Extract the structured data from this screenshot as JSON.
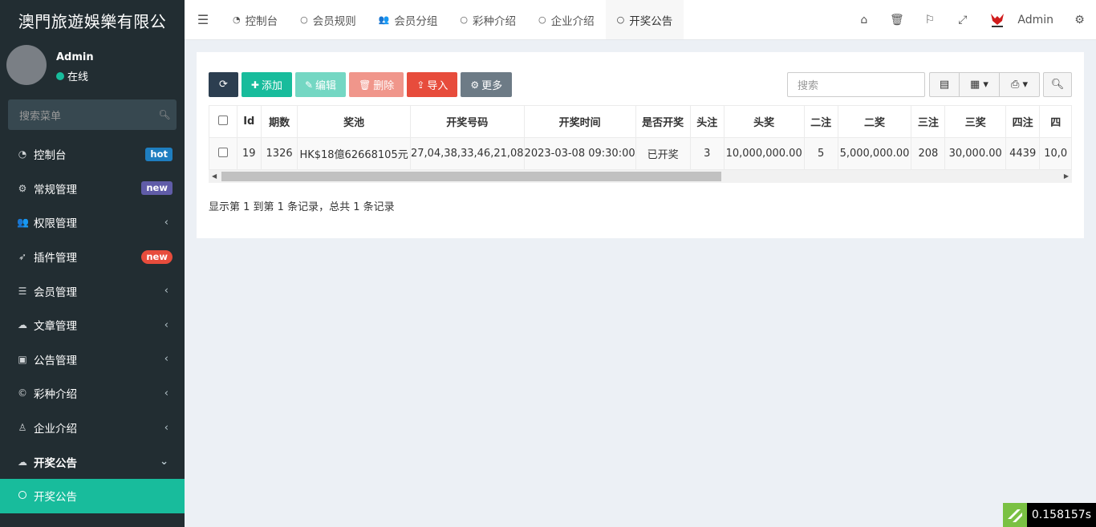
{
  "brand": "澳門旅遊娛樂有限公",
  "user": {
    "name": "Admin",
    "status": "在线"
  },
  "sidebar": {
    "search_placeholder": "搜索菜单",
    "items": [
      {
        "icon": "dashboard-icon",
        "glyph": "◔",
        "label": "控制台",
        "badge": "hot",
        "badge_color": "#1e7ec0"
      },
      {
        "icon": "cogs-icon",
        "glyph": "⚙",
        "label": "常规管理",
        "badge": "new",
        "badge_color": "#605ca8"
      },
      {
        "icon": "group-icon",
        "glyph": "👥",
        "label": "权限管理",
        "arrow": "‹"
      },
      {
        "icon": "rocket-icon",
        "glyph": "➶",
        "label": "插件管理",
        "badge": "new",
        "badge_color": "#e74c3c"
      },
      {
        "icon": "list-icon",
        "glyph": "☰",
        "label": "会员管理",
        "arrow": "‹"
      },
      {
        "icon": "cloud-icon",
        "glyph": "☁",
        "label": "文章管理",
        "arrow": "‹"
      },
      {
        "icon": "briefcase-icon",
        "glyph": "▣",
        "label": "公告管理",
        "arrow": "‹"
      },
      {
        "icon": "copyright-icon",
        "glyph": "©",
        "label": "彩种介绍",
        "arrow": "‹"
      },
      {
        "icon": "child-icon",
        "glyph": "♙",
        "label": "企业介绍",
        "arrow": "‹"
      },
      {
        "icon": "cloud-icon",
        "glyph": "☁",
        "label": "开奖公告",
        "arrow": "⌄"
      },
      {
        "icon": "circle-icon",
        "glyph": "",
        "label": "开奖公告"
      }
    ]
  },
  "topnav": {
    "tabs": [
      {
        "icon": "dashboard-icon",
        "glyph": "◔",
        "label": "控制台"
      },
      {
        "icon": "circle-icon",
        "glyph": "○",
        "label": "会员规则"
      },
      {
        "icon": "users-icon",
        "glyph": "👥",
        "label": "会员分组"
      },
      {
        "icon": "circle-icon",
        "glyph": "○",
        "label": "彩种介绍"
      },
      {
        "icon": "circle-icon",
        "glyph": "○",
        "label": "企业介绍"
      },
      {
        "icon": "circle-icon",
        "glyph": "○",
        "label": "开奖公告"
      }
    ],
    "admin_name": "Admin"
  },
  "toolbar": {
    "add": "添加",
    "edit": "编辑",
    "delete": "删除",
    "import": "导入",
    "more": "更多",
    "search_placeholder": "搜索"
  },
  "table": {
    "columns": [
      "Id",
      "期数",
      "奖池",
      "开奖号码",
      "开奖时间",
      "是否开奖",
      "头注",
      "头奖",
      "二注",
      "二奖",
      "三注",
      "三奖",
      "四注",
      "四"
    ],
    "rows": [
      [
        "19",
        "1326",
        "HK$18億62668105元",
        "27,04,38,33,46,21,08",
        "2023-03-08 09:30:00",
        "已开奖",
        "3",
        "10,000,000.00",
        "5",
        "5,000,000.00",
        "208",
        "30,000.00",
        "4439",
        "10,0"
      ]
    ]
  },
  "page_info": "显示第 1 到第 1 条记录，总共 1 条记录",
  "timer": "0.158157s",
  "colors": {
    "sidebar_bg": "#222d32",
    "accent": "#18bc9c",
    "danger": "#e74c3c"
  }
}
